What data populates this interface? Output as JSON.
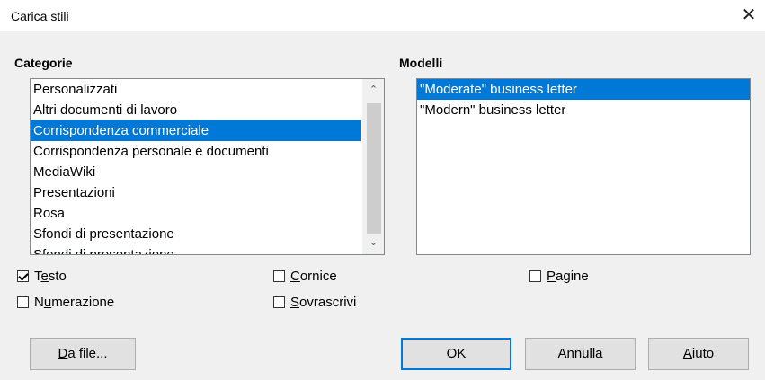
{
  "window": {
    "title": "Carica stili",
    "close_glyph": "✕"
  },
  "categories": {
    "label": "Categorie",
    "items": [
      "Personalizzati",
      "Altri documenti di lavoro",
      "Corrispondenza commerciale",
      "Corrispondenza personale e documenti",
      "MediaWiki",
      "Presentazioni",
      "Rosa",
      "Sfondi di presentazione",
      "Sfondi di presentazione"
    ],
    "selected_index": 2
  },
  "models": {
    "label": "Modelli",
    "items": [
      "\"Moderate\" business letter",
      "\"Modern\" business letter"
    ],
    "selected_index": 0
  },
  "options": {
    "testo": {
      "pre": "T",
      "ul": "e",
      "post": "sto",
      "checked": true
    },
    "cornice": {
      "pre": "",
      "ul": "C",
      "post": "ornice",
      "checked": false
    },
    "pagine": {
      "pre": "",
      "ul": "P",
      "post": "agine",
      "checked": false
    },
    "numerazione": {
      "pre": "N",
      "ul": "u",
      "post": "merazione",
      "checked": false
    },
    "sovrascrivi": {
      "pre": "",
      "ul": "S",
      "post": "ovrascrivi",
      "checked": false
    }
  },
  "buttons": {
    "from_file": {
      "ul": "D",
      "post": "a file..."
    },
    "ok": "OK",
    "cancel": "Annulla",
    "help": {
      "ul": "A",
      "post": "iuto"
    }
  },
  "colors": {
    "selection": "#0078d7",
    "default_border": "#0078d7"
  }
}
